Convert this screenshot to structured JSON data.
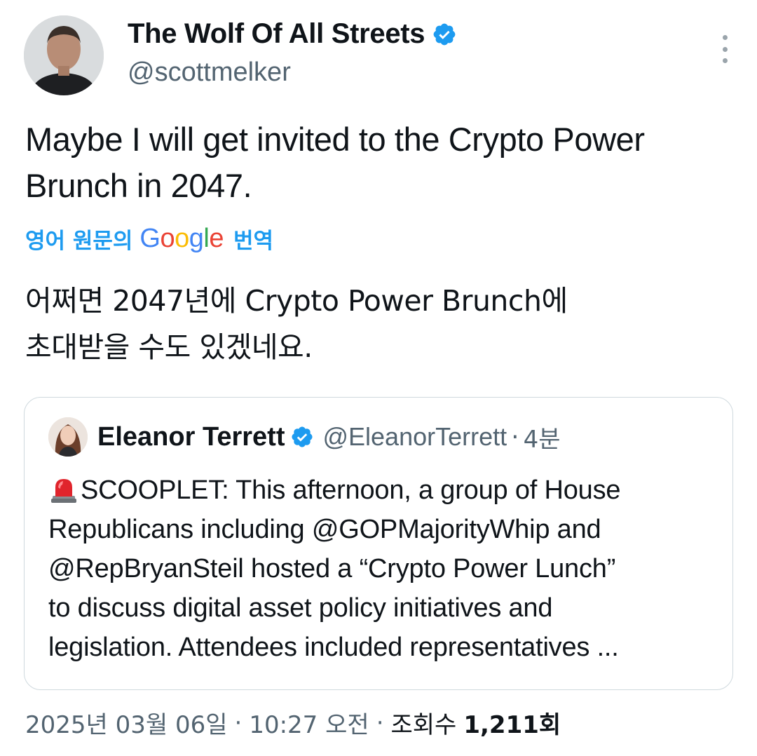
{
  "author": {
    "display_name": "The Wolf Of All Streets",
    "handle": "@scottmelker",
    "verified": true
  },
  "tweet": {
    "text_line1": "Maybe I will get invited to the Crypto Power",
    "text_line2": "Brunch in 2047.",
    "translate_prefix": "영어 원문의",
    "translate_google": "Google",
    "translate_suffix": "번역",
    "translated_line1": "어쩌면 2047년에 Crypto Power Brunch에",
    "translated_line2": "초대받을 수도 있겠네요."
  },
  "quote": {
    "display_name": "Eleanor Terrett",
    "handle": "@EleanorTerrett",
    "dot": "·",
    "time": "4분",
    "emoji": "rotating-light-icon",
    "line1": "SCOOPLET: This afternoon, a group of House",
    "line2": "Republicans including @GOPMajorityWhip and",
    "line3": "@RepBryanSteil hosted a “Crypto Power Lunch”",
    "line4": "to discuss digital asset policy initiatives and",
    "line5": "legislation. Attendees included representatives ..."
  },
  "meta": {
    "date": "2025년 03월 06일",
    "sep1": "·",
    "time": "10:27 오전",
    "sep2": "·",
    "views_label": "조회수",
    "views_count": "1,211회"
  },
  "colors": {
    "link_blue": "#1d9bf0",
    "verified_blue": "#1d9bf0",
    "secondary_text": "#536471",
    "border": "#cfd9de"
  }
}
